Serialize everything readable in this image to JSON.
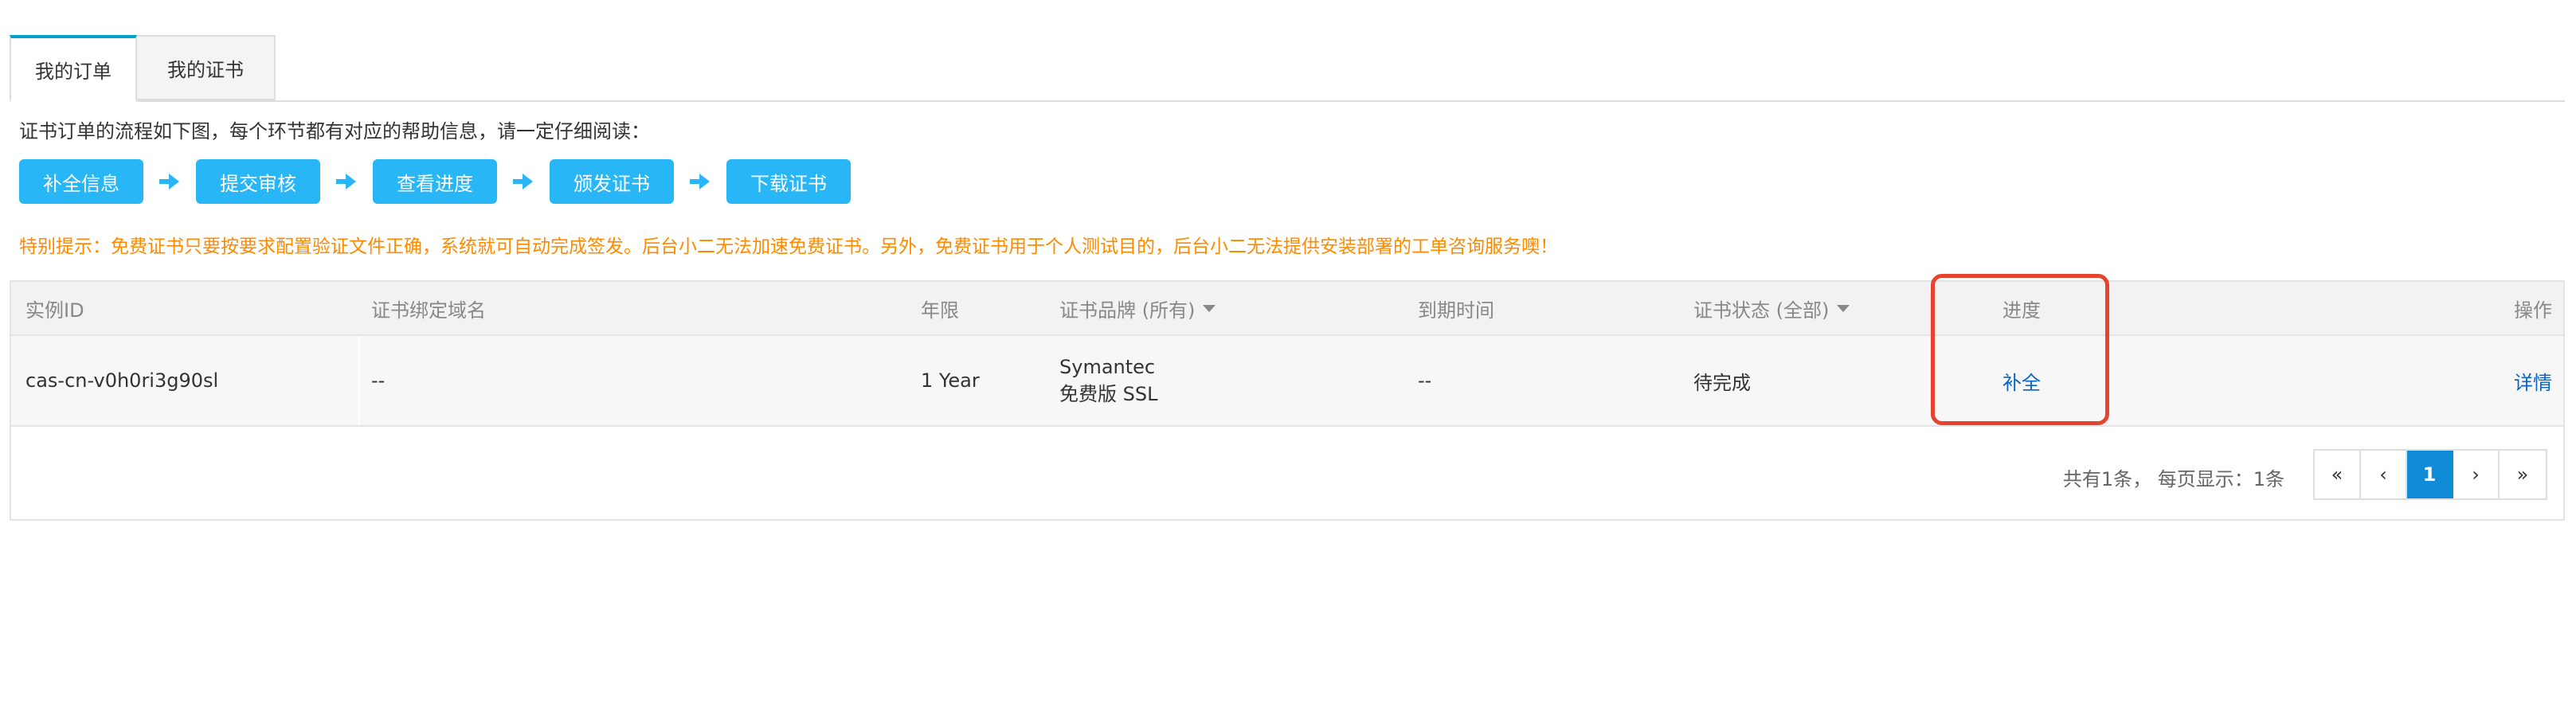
{
  "tabs": {
    "orders": "我的订单",
    "certificates": "我的证书"
  },
  "intro": "证书订单的流程如下图，每个环节都有对应的帮助信息，请一定仔细阅读：",
  "flow_steps": [
    "补全信息",
    "提交审核",
    "查看进度",
    "颁发证书",
    "下载证书"
  ],
  "warning": "特别提示：免费证书只要按要求配置验证文件正确，系统就可自动完成签发。后台小二无法加速免费证书。另外，免费证书用于个人测试目的，后台小二无法提供安装部署的工单咨询服务噢！",
  "table": {
    "headers": {
      "instance_id": "实例ID",
      "domain": "证书绑定域名",
      "term": "年限",
      "brand": "证书品牌 (所有)",
      "expiry": "到期时间",
      "status": "证书状态 (全部)",
      "progress": "进度",
      "actions": "操作"
    },
    "rows": [
      {
        "instance_id": "cas-cn-v0h0ri3g90sl",
        "domain": "--",
        "term": "1 Year",
        "brand_line1": "Symantec",
        "brand_line2": "免费版 SSL",
        "expiry": "--",
        "status": "待完成",
        "progress": "补全",
        "action": "详情"
      }
    ]
  },
  "pagination": {
    "info": "共有1条，  每页显示：1条",
    "first": "«",
    "prev": "‹",
    "current": "1",
    "next": "›",
    "last": "»"
  },
  "colors": {
    "accent": "#29b6f6",
    "warning": "#ff8a00",
    "link": "#0a63c7",
    "highlight": "#e5432d",
    "page_active": "#0f8bd7"
  },
  "icons": {
    "flow_arrow": "arrow-right-icon",
    "sort_caret": "caret-down-icon"
  }
}
